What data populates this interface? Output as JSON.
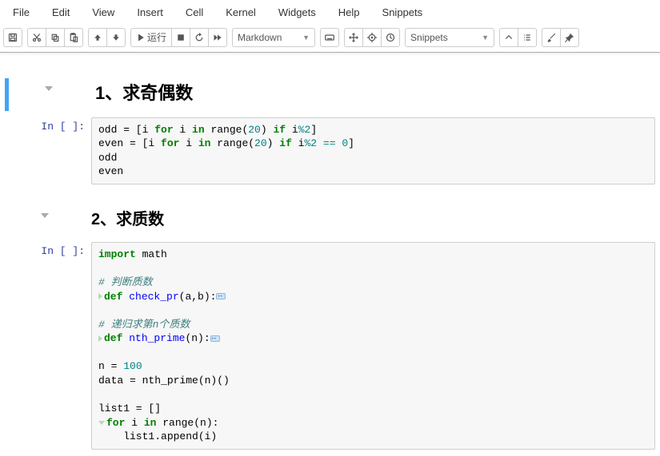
{
  "menubar": {
    "items": [
      {
        "label": "File"
      },
      {
        "label": "Edit"
      },
      {
        "label": "View"
      },
      {
        "label": "Insert"
      },
      {
        "label": "Cell"
      },
      {
        "label": "Kernel"
      },
      {
        "label": "Widgets"
      },
      {
        "label": "Help"
      },
      {
        "label": "Snippets"
      }
    ]
  },
  "toolbar": {
    "run_label": "运行",
    "celltype_selected": "Markdown",
    "snippets_selected": "Snippets"
  },
  "cells": [
    {
      "type": "markdown",
      "selected": true,
      "heading": "1、求奇偶数"
    },
    {
      "type": "code",
      "prompt": "In [ ]:",
      "code_plain": "odd = [i for i in range(20) if i%2]\neven = [i for i in range(20) if i%2 == 0]\nodd\neven"
    },
    {
      "type": "markdown",
      "selected": false,
      "heading": "2、求质数"
    },
    {
      "type": "code",
      "prompt": "In [ ]:",
      "code_plain": "import math\n\n# 判断质数\ndef check_pr(a,b):↔\n\n# 递归求第n个质数\ndef nth_prime(n):↔\n\nn = 100\ndata = nth_prime(n)()\n\nlist1 = []\nfor i in range(n):\n    list1.append(i)"
    }
  ]
}
